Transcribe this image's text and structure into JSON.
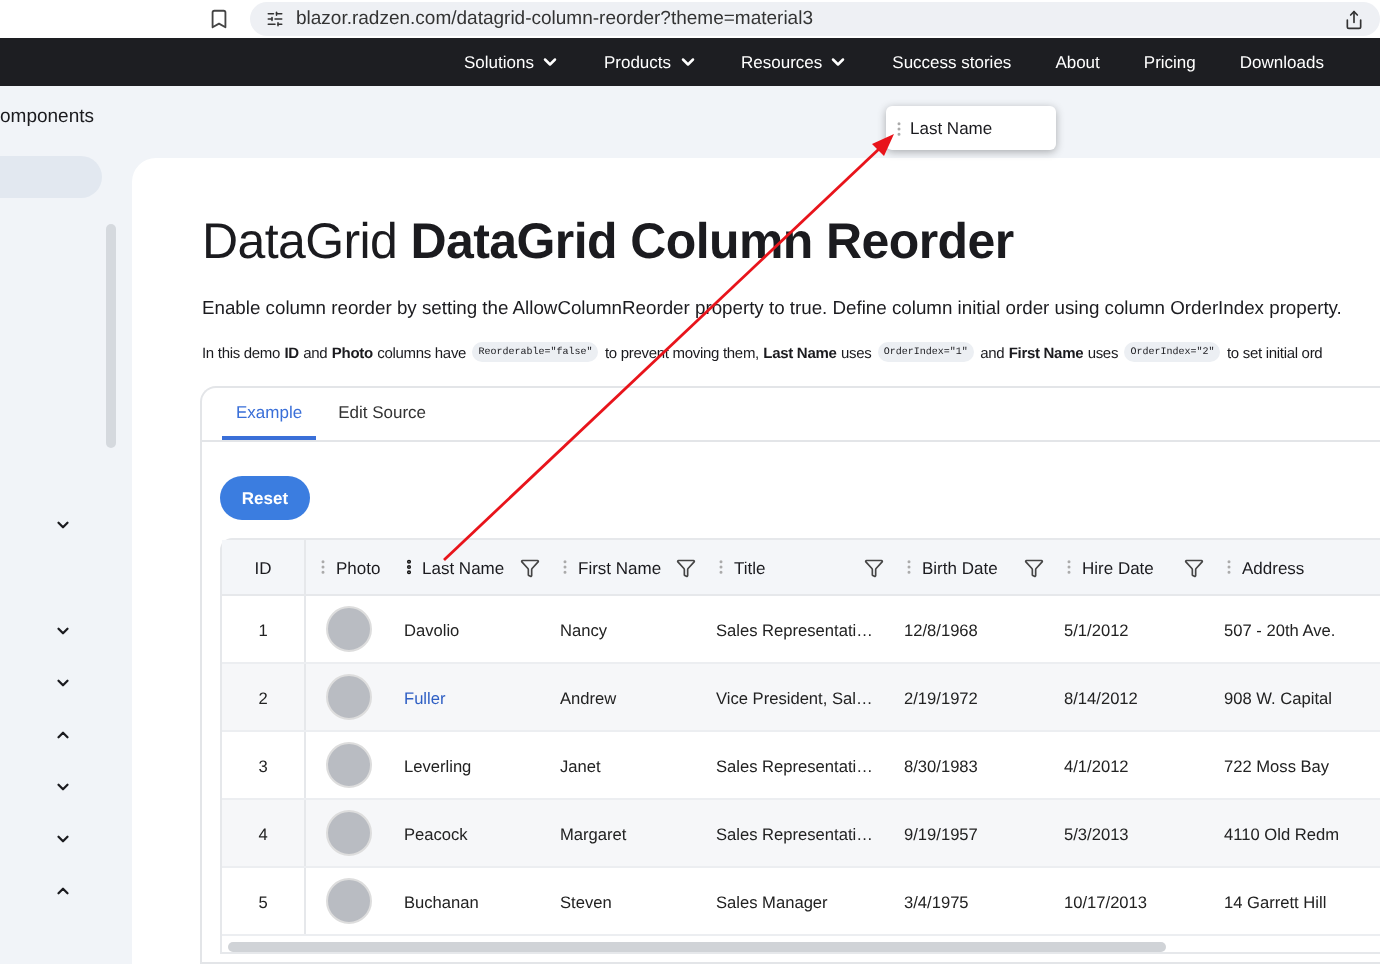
{
  "browser": {
    "url": "blazor.radzen.com/datagrid-column-reorder?theme=material3"
  },
  "nav": [
    {
      "label": "Solutions",
      "has_menu": true
    },
    {
      "label": "Products",
      "has_menu": true
    },
    {
      "label": "Resources",
      "has_menu": true
    },
    {
      "label": "Success stories",
      "has_menu": false
    },
    {
      "label": "About",
      "has_menu": false
    },
    {
      "label": "Pricing",
      "has_menu": false
    },
    {
      "label": "Downloads",
      "has_menu": false
    }
  ],
  "sidebar": {
    "heading": "omponents",
    "groups": [
      {
        "expanded": false
      },
      {
        "expanded": false
      },
      {
        "expanded": false
      },
      {
        "expanded": true
      },
      {
        "expanded": false
      },
      {
        "expanded": false
      },
      {
        "expanded": true
      }
    ]
  },
  "page": {
    "title": "DataGrid **DataGrid Column Reorder**",
    "description": "Enable column reorder by setting the AllowColumnReorder property to true. Define column initial order using column OrderIndex property.",
    "demo_note": [
      {
        "kind": "text",
        "text": "In this demo"
      },
      {
        "kind": "bold",
        "text": "ID"
      },
      {
        "kind": "text",
        "text": "and"
      },
      {
        "kind": "bold",
        "text": "Photo"
      },
      {
        "kind": "text",
        "text": "columns have"
      },
      {
        "kind": "code",
        "text": "Reorderable=\"false\""
      },
      {
        "kind": "text",
        "text": "to prevent moving them,"
      },
      {
        "kind": "bold",
        "text": "Last Name"
      },
      {
        "kind": "text",
        "text": "uses"
      },
      {
        "kind": "code",
        "text": "OrderIndex=\"1\""
      },
      {
        "kind": "text",
        "text": "and"
      },
      {
        "kind": "bold",
        "text": "First Name"
      },
      {
        "kind": "text",
        "text": "uses"
      },
      {
        "kind": "code",
        "text": "OrderIndex=\"2\""
      },
      {
        "kind": "text",
        "text": "to set initial ord"
      }
    ]
  },
  "tabs": [
    {
      "label": "Example",
      "selected": true
    },
    {
      "label": "Edit Source",
      "selected": false
    }
  ],
  "reset_button": "Reset",
  "grid": {
    "columns": [
      {
        "label": "ID",
        "reorderable": false,
        "filter": false
      },
      {
        "label": "Photo",
        "reorderable": true,
        "filter": false,
        "dragging": false
      },
      {
        "label": "Last Name",
        "reorderable": true,
        "filter": true,
        "dragging": true
      },
      {
        "label": "First Name",
        "reorderable": true,
        "filter": true,
        "dragging": false
      },
      {
        "label": "Title",
        "reorderable": true,
        "filter": true,
        "dragging": false
      },
      {
        "label": "Birth Date",
        "reorderable": true,
        "filter": true,
        "dragging": false
      },
      {
        "label": "Hire Date",
        "reorderable": true,
        "filter": true,
        "dragging": false
      },
      {
        "label": "Address",
        "reorderable": true,
        "filter": false,
        "dragging": false
      }
    ],
    "rows": [
      {
        "id": "1",
        "last_name": "Davolio",
        "first_name": "Nancy",
        "title": "Sales Representati…",
        "birth_date": "12/8/1968",
        "hire_date": "5/1/2012",
        "address": "507 - 20th Ave.",
        "hovered": false
      },
      {
        "id": "2",
        "last_name": "Fuller",
        "first_name": "Andrew",
        "title": "Vice President, Sal…",
        "birth_date": "2/19/1972",
        "hire_date": "8/14/2012",
        "address": "908 W. Capital",
        "hovered": true
      },
      {
        "id": "3",
        "last_name": "Leverling",
        "first_name": "Janet",
        "title": "Sales Representati…",
        "birth_date": "8/30/1983",
        "hire_date": "4/1/2012",
        "address": "722 Moss Bay",
        "hovered": false
      },
      {
        "id": "4",
        "last_name": "Peacock",
        "first_name": "Margaret",
        "title": "Sales Representati…",
        "birth_date": "9/19/1957",
        "hire_date": "5/3/2013",
        "address": "4110 Old Redm",
        "hovered": false
      },
      {
        "id": "5",
        "last_name": "Buchanan",
        "first_name": "Steven",
        "title": "Sales Manager",
        "birth_date": "3/4/1975",
        "hire_date": "10/17/2013",
        "address": "14 Garrett Hill",
        "hovered": false
      }
    ]
  },
  "drag_ghost": {
    "label": "Last Name"
  }
}
